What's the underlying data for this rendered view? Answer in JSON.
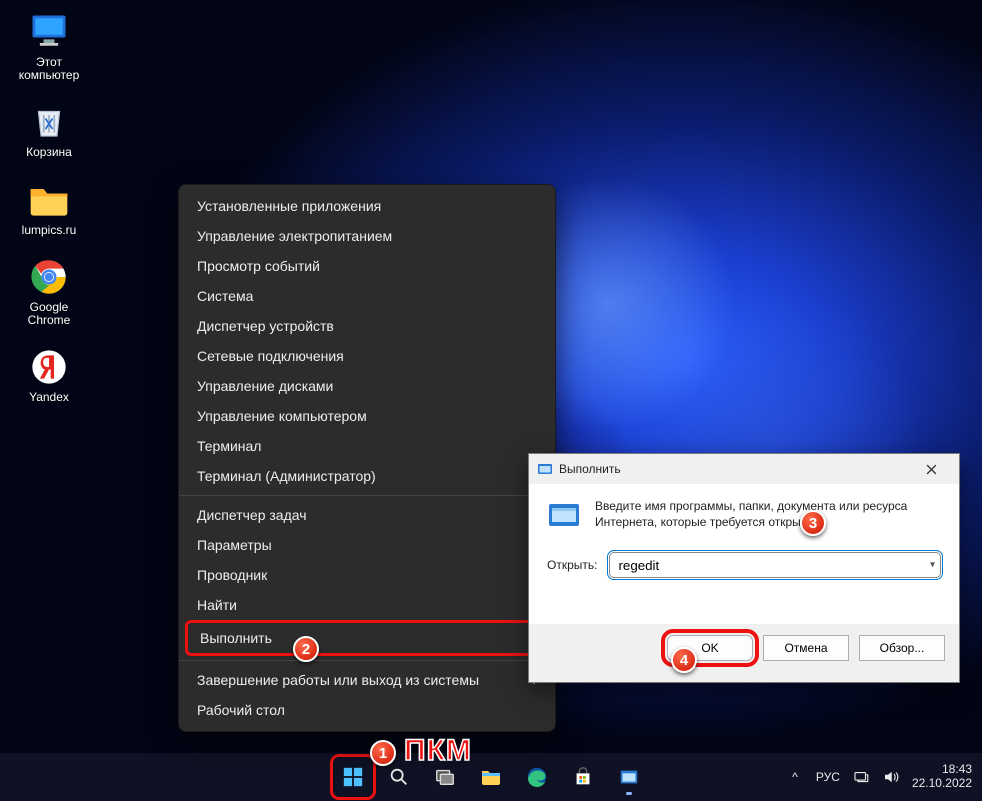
{
  "desktop_icons": [
    {
      "label": "Этот компьютер",
      "kind": "pc"
    },
    {
      "label": "Корзина",
      "kind": "bin"
    },
    {
      "label": "lumpics.ru",
      "kind": "folder"
    },
    {
      "label": "Google Chrome",
      "kind": "chrome"
    },
    {
      "label": "Yandex",
      "kind": "yandex"
    }
  ],
  "context_menu": {
    "groups": [
      [
        "Установленные приложения",
        "Управление электропитанием",
        "Просмотр событий",
        "Система",
        "Диспетчер устройств",
        "Сетевые подключения",
        "Управление дисками",
        "Управление компьютером",
        "Терминал",
        "Терминал (Администратор)"
      ],
      [
        "Диспетчер задач",
        "Параметры",
        "Проводник",
        "Найти",
        "Выполнить"
      ],
      [
        "Завершение работы или выход из системы",
        "Рабочий стол"
      ]
    ],
    "highlighted": "Выполнить",
    "arrow_item": "Завершение работы или выход из системы"
  },
  "run_dialog": {
    "title": "Выполнить",
    "description": "Введите имя программы, папки, документа или ресурса Интернета, которые требуется открыть.",
    "open_label": "Открыть:",
    "input_value": "regedit",
    "buttons": {
      "ok": "OK",
      "cancel": "Отмена",
      "browse": "Обзор..."
    }
  },
  "annotations": {
    "pkm_text": "ПКМ",
    "b1": "1",
    "b2": "2",
    "b3": "3",
    "b4": "4"
  },
  "tray": {
    "lang": "РУС",
    "time": "18:43",
    "date": "22.10.2022",
    "chevron": "^"
  }
}
